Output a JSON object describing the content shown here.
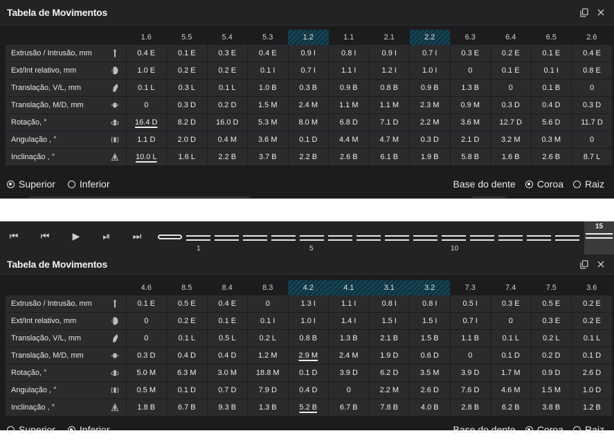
{
  "panel_title": "Tabela de Movimentos",
  "row_labels": [
    "Extrusão / Intrusão, mm",
    "Ext/Int relativo, mm",
    "Translação, V/L, mm",
    "Translação, M/D, mm",
    "Rotação, °",
    "Angulação , °",
    "Inclinação , °"
  ],
  "row_icons": [
    "extrusion-icon",
    "relative-extrusion-icon",
    "translation-vl-icon",
    "translation-md-icon",
    "rotation-icon",
    "angulation-icon",
    "inclination-icon"
  ],
  "upper": {
    "teeth": [
      "1.6",
      "5.5",
      "5.4",
      "5.3",
      "1.2",
      "1.1",
      "2.1",
      "2.2",
      "6.3",
      "6.4",
      "6.5",
      "2.6"
    ],
    "rows": [
      [
        "0.4 E",
        "0.1 E",
        "0.3 E",
        "0.4 E",
        "0.9 I",
        "0.8 I",
        "0.9 I",
        "0.7 I",
        "0.3 E",
        "0.2 E",
        "0.1 E",
        "0.4 E"
      ],
      [
        "1.0 E",
        "0.2 E",
        "0.2 E",
        "0.1 I",
        "0.7 I",
        "1.1 I",
        "1.2 I",
        "1.0 I",
        "0",
        "0.1 E",
        "0.1 I",
        "0.8 E"
      ],
      [
        "0.1 L",
        "0.3 L",
        "0.1 L",
        "1.0 B",
        "0.3 B",
        "0.9 B",
        "0.8 B",
        "0.9 B",
        "1.3 B",
        "0",
        "0.1 B",
        "0"
      ],
      [
        "0",
        "0.3 D",
        "0.2 D",
        "1.5 M",
        "2.4 M",
        "1.1 M",
        "1.1 M",
        "2.3 M",
        "0.9 M",
        "0.3 D",
        "0.4 D",
        "0.3 D"
      ],
      [
        "16.4 D",
        "8.2 D",
        "16.0 D",
        "5.3 M",
        "8.0 M",
        "6.8 D",
        "7.1 D",
        "2.2 M",
        "3.6 M",
        "12.7 D",
        "5.6 D",
        "11.7 D"
      ],
      [
        "1.1 D",
        "2.0 D",
        "0.4 M",
        "3.6 M",
        "0.1 D",
        "4.4 M",
        "4.7 M",
        "0.3 D",
        "2.1 D",
        "3.2 M",
        "0.3 M",
        "0"
      ],
      [
        "10.0 L",
        "1.6 L",
        "2.2 B",
        "3.7 B",
        "2.2 B",
        "2.6 B",
        "6.1 B",
        "1.9 B",
        "5.8 B",
        "1.6 B",
        "2.6 B",
        "8.7 L"
      ]
    ],
    "arch_options": [
      "Superior",
      "Inferior"
    ],
    "arch_selected": "Superior",
    "base_label": "Base do dente",
    "base_options": [
      "Coroa",
      "Raiz"
    ],
    "base_selected": "Coroa"
  },
  "timeline": {
    "labels": [
      "1",
      "5",
      "10"
    ],
    "current_step": "15"
  },
  "lower": {
    "teeth": [
      "4.6",
      "8.5",
      "8.4",
      "8.3",
      "4.2",
      "4.1",
      "3.1",
      "3.2",
      "7.3",
      "7.4",
      "7.5",
      "3.6"
    ],
    "rows": [
      [
        "0.1 E",
        "0.5 E",
        "0.4 E",
        "0",
        "1.3 I",
        "1.1 I",
        "0.8 I",
        "0.8 I",
        "0.5 I",
        "0.3 E",
        "0.5 E",
        "0.2 E"
      ],
      [
        "0",
        "0.2 E",
        "0.1 E",
        "0.1 I",
        "1.0 I",
        "1.4 I",
        "1.5 I",
        "1.5 I",
        "0.7 I",
        "0",
        "0.3 E",
        "0.2 E"
      ],
      [
        "0",
        "0.1 L",
        "0.5 L",
        "0.2 L",
        "0.8 B",
        "1.3 B",
        "2.1 B",
        "1.5 B",
        "1.1 B",
        "0.1 L",
        "0.2 L",
        "0.1 L"
      ],
      [
        "0.3 D",
        "0.4 D",
        "0.4 D",
        "1.2 M",
        "2.9 M",
        "2.4 M",
        "1.9 D",
        "0.6 D",
        "0",
        "0.1 D",
        "0.2 D",
        "0.1 D"
      ],
      [
        "5.0 M",
        "6.3 M",
        "3.0 M",
        "18.8 M",
        "0.1 D",
        "3.9 D",
        "6.2 D",
        "3.5 M",
        "3.9 D",
        "1.7 M",
        "0.9 D",
        "2.6 D"
      ],
      [
        "0.5 M",
        "0.1 D",
        "0.7 D",
        "7.9 D",
        "0.4 D",
        "0",
        "2.2 M",
        "2.6 D",
        "7.6 D",
        "4.6 M",
        "1.5 M",
        "1.0 D"
      ],
      [
        "1.8 B",
        "6.7 B",
        "9.3 B",
        "1.3 B",
        "5.2 B",
        "6.7 B",
        "7.8 B",
        "4.0 B",
        "2.8 B",
        "6.2 B",
        "3.8 B",
        "1.2 B"
      ]
    ],
    "arch_options": [
      "Superior",
      "Inferior"
    ],
    "arch_selected": "Inferior",
    "base_label": "Base do dente",
    "base_options": [
      "Coroa",
      "Raiz"
    ],
    "base_selected": "Coroa"
  },
  "highlight_color": "#15495b"
}
